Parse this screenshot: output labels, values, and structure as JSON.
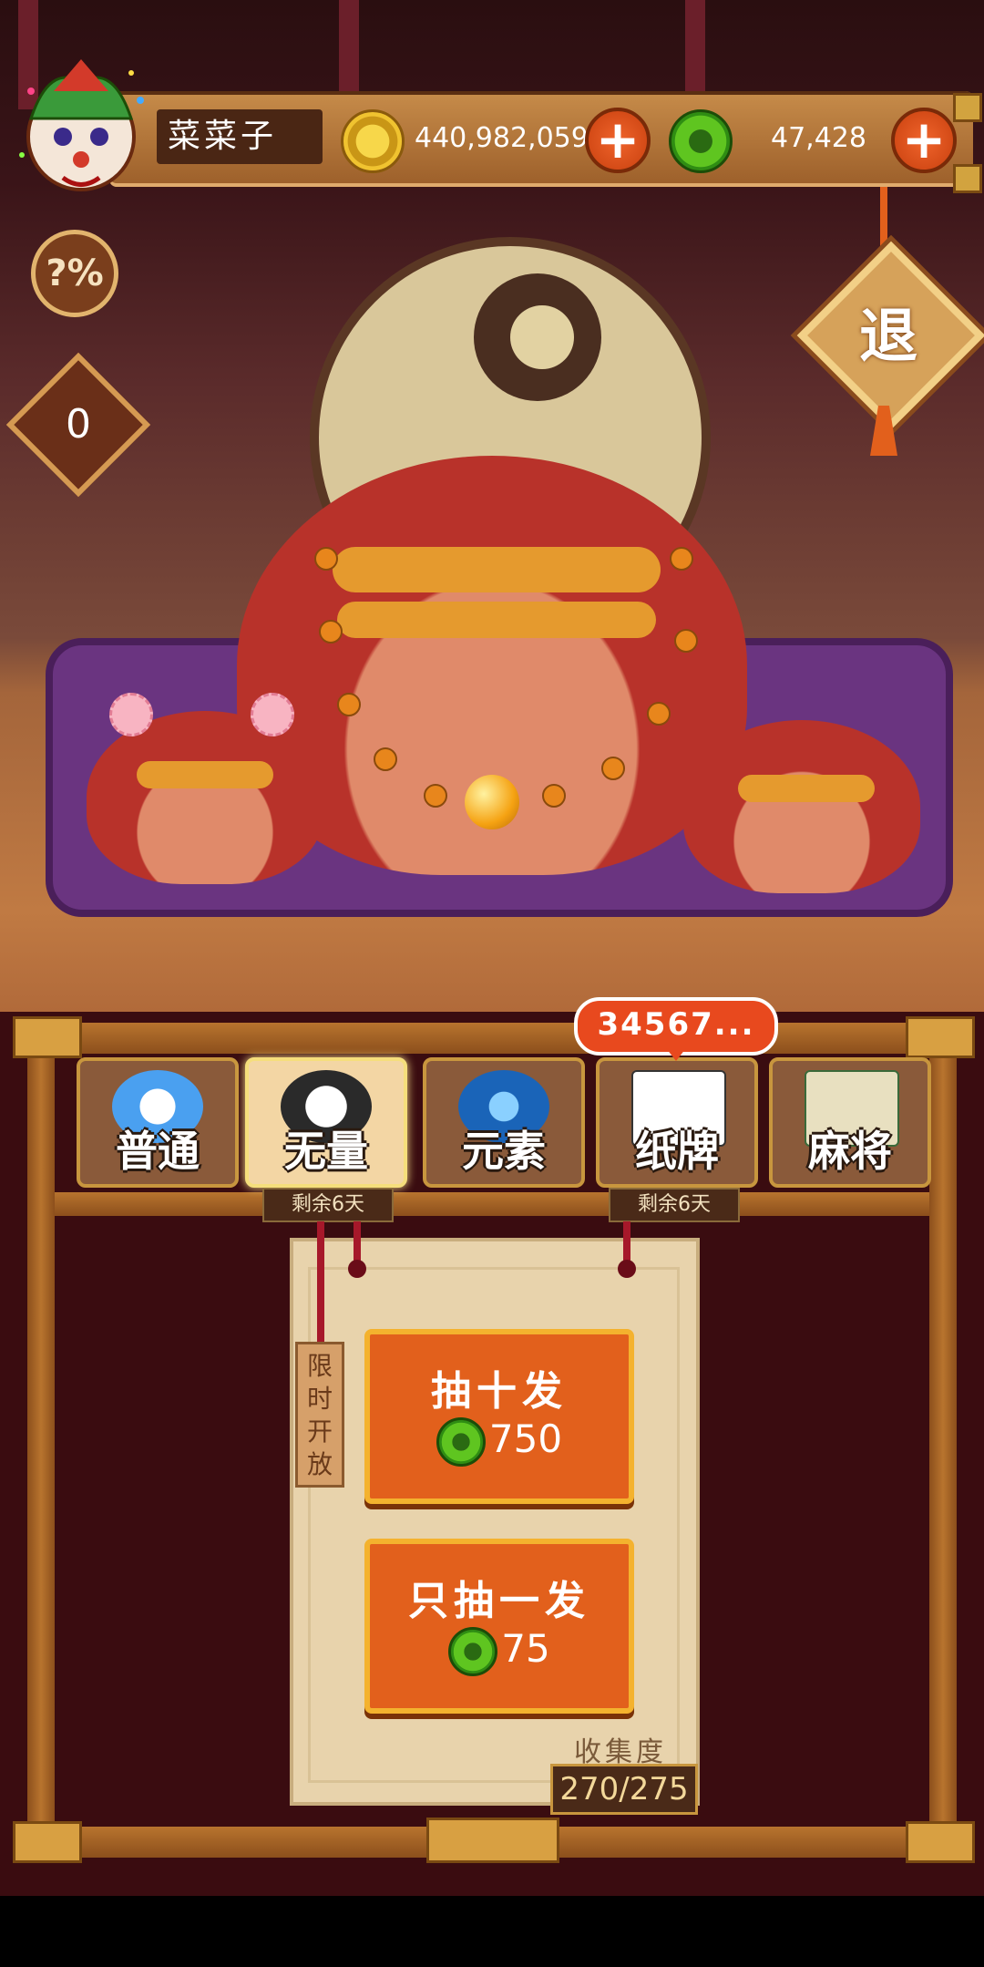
{
  "header": {
    "player_name": "菜菜子",
    "gold_amount": "440,982,059",
    "jade_amount": "47,428"
  },
  "side": {
    "odds_label": "?%",
    "counter": "0",
    "exit_label": "退"
  },
  "tabs": [
    {
      "label": "普通",
      "active": false
    },
    {
      "label": "无量",
      "active": true,
      "remaining": "剩余6天"
    },
    {
      "label": "元素",
      "active": false
    },
    {
      "label": "纸牌",
      "active": false,
      "remaining": "剩余6天",
      "bubble": "34567..."
    },
    {
      "label": "麻将",
      "active": false
    }
  ],
  "panel": {
    "tag_chars": [
      "限",
      "时",
      "开",
      "放"
    ],
    "draw_ten_label": "抽十发",
    "draw_ten_cost": "750",
    "draw_one_label": "只抽一发",
    "draw_one_cost": "75",
    "collection_label": "收集度",
    "collection_value": "270/275"
  },
  "icons": [
    "jester-avatar-icon",
    "gold-coin-icon",
    "jade-coin-icon",
    "plus-icon",
    "exit-icon"
  ],
  "colors": {
    "accent": "#e2601c",
    "board": "#3a0c10",
    "gold": "#f0c330",
    "jade": "#5fc520"
  }
}
